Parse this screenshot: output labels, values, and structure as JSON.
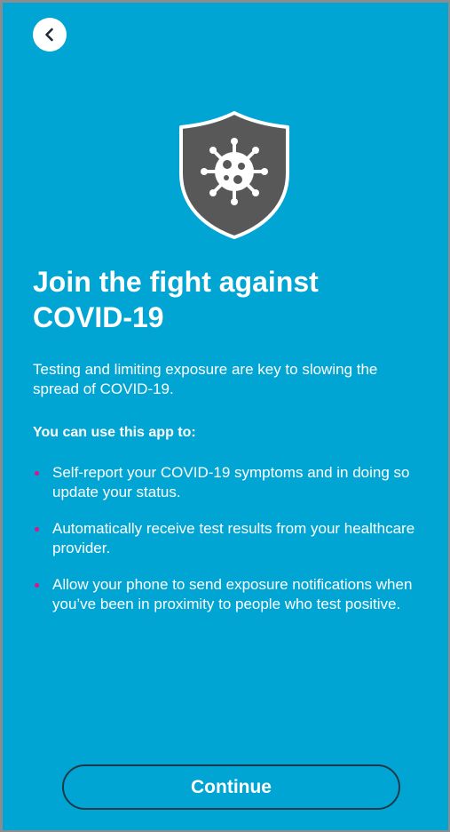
{
  "header": {
    "back_icon": "chevron-left-icon"
  },
  "hero": {
    "icon": "shield-virus-icon",
    "shield_color": "#585858"
  },
  "content": {
    "title": "Join the fight against COVID-19",
    "intro": "Testing and limiting exposure are key to slowing the spread of COVID-19.",
    "subhead": "You can use this app to:",
    "features": [
      "Self-report your COVID-19 symptoms and in doing so update your status.",
      "Automatically receive test results from your healthcare provider.",
      "Allow your phone to send exposure notifications when you’ve been in proximity to people who test positive."
    ]
  },
  "footer": {
    "continue_label": "Continue"
  },
  "colors": {
    "background": "#00a5d4",
    "bullet": "#e0118a",
    "button_border": "#1e3a4a"
  }
}
